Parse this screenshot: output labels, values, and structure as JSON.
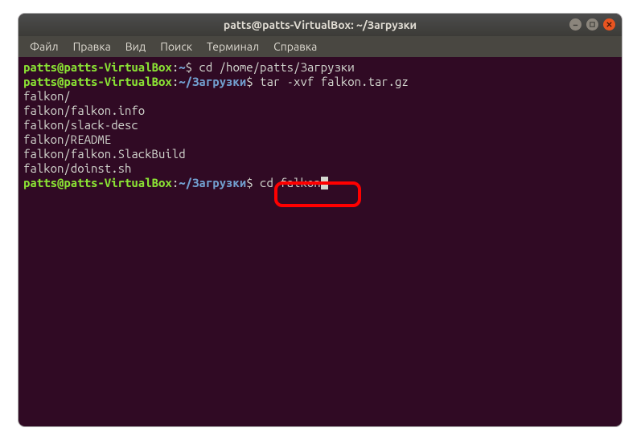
{
  "window": {
    "title": "patts@patts-VirtualBox: ~/Загрузки"
  },
  "menu": {
    "items": [
      "Файл",
      "Правка",
      "Вид",
      "Поиск",
      "Терминал",
      "Справка"
    ]
  },
  "terminal": {
    "lines": [
      {
        "user": "patts@patts-VirtualBox",
        "path": "~",
        "cmd": "cd /home/patts/Загрузки"
      },
      {
        "user": "patts@patts-VirtualBox",
        "path": "~/Загрузки",
        "cmd": "tar -xvf falkon.tar.gz"
      },
      {
        "out": "falkon/"
      },
      {
        "out": "falkon/falkon.info"
      },
      {
        "out": "falkon/slack-desc"
      },
      {
        "out": "falkon/README"
      },
      {
        "out": "falkon/falkon.SlackBuild"
      },
      {
        "out": "falkon/doinst.sh"
      },
      {
        "user": "patts@patts-VirtualBox",
        "path": "~/Загрузки",
        "cmd": "cd falkon",
        "cursor": true
      }
    ]
  }
}
